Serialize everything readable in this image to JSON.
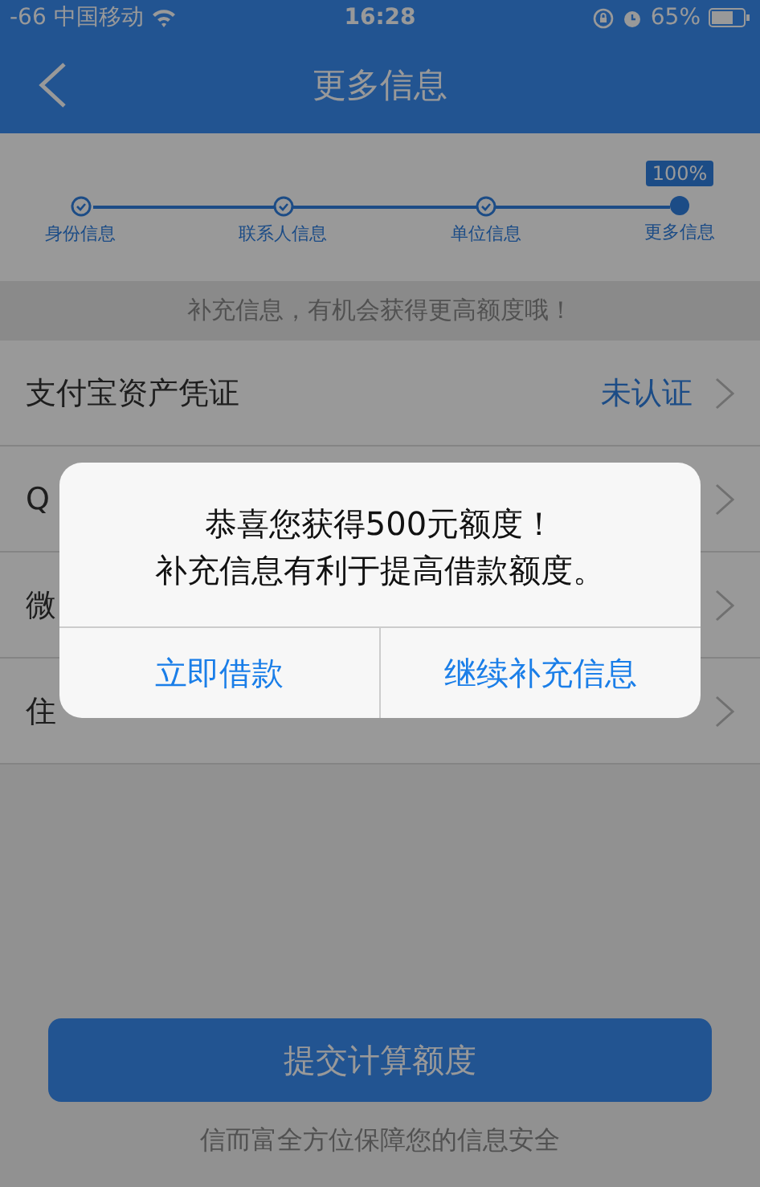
{
  "status_bar": {
    "carrier": "-66 中国移动",
    "time": "16:28",
    "battery": "65%"
  },
  "nav": {
    "title": "更多信息"
  },
  "progress": {
    "badge": "100%",
    "steps": [
      {
        "label": "身份信息",
        "selected": false
      },
      {
        "label": "联系人信息",
        "selected": false
      },
      {
        "label": "单位信息",
        "selected": false
      },
      {
        "label": "更多信息",
        "selected": true
      }
    ]
  },
  "hint": "补充信息，有机会获得更高额度哦！",
  "rows": [
    {
      "label": "支付宝资产凭证",
      "status": "未认证"
    },
    {
      "label": "Q"
    },
    {
      "label": "微"
    },
    {
      "label": "住"
    }
  ],
  "submit_button": "提交计算额度",
  "footer": "信而富全方位保障您的信息安全",
  "alert": {
    "lines": [
      "恭喜您获得500元额度！",
      "补充信息有利于提高借款额度。"
    ],
    "buttons": [
      "立即借款",
      "继续补充信息"
    ]
  }
}
